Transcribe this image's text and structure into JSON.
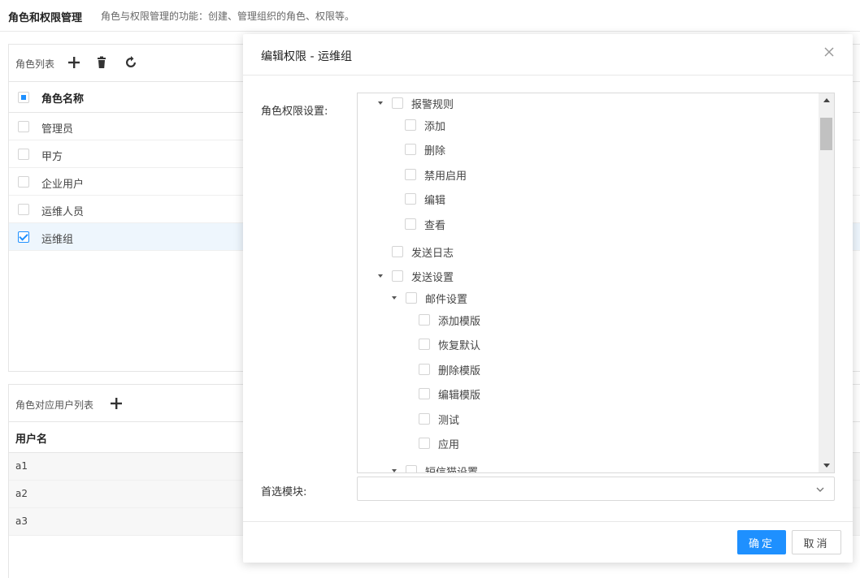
{
  "header": {
    "title": "角色和权限管理",
    "description": "角色与权限管理的功能：创建、管理组织的角色、权限等。"
  },
  "role_panel": {
    "title": "角色列表",
    "column_header": "角色名称",
    "roles": [
      {
        "name": "管理员",
        "checked": false
      },
      {
        "name": "甲方",
        "checked": false
      },
      {
        "name": "企业用户",
        "checked": false
      },
      {
        "name": "运维人员",
        "checked": false
      },
      {
        "name": "运维组",
        "checked": true
      }
    ]
  },
  "user_panel": {
    "title": "角色对应用户列表",
    "column_header": "用户名",
    "users": [
      "a1",
      "a2",
      "a3"
    ]
  },
  "modal": {
    "title": "编辑权限 - 运维组",
    "permission_label": "角色权限设置:",
    "tree": {
      "alert_rules": {
        "label": "报警规则",
        "children": [
          "添加",
          "删除",
          "禁用启用",
          "编辑",
          "查看"
        ]
      },
      "send_log": {
        "label": "发送日志"
      },
      "send_settings": {
        "label": "发送设置",
        "mail_settings": {
          "label": "邮件设置",
          "children": [
            "添加模版",
            "恢复默认",
            "删除模版",
            "编辑模版",
            "测试",
            "应用"
          ]
        },
        "sms_settings": {
          "label": "短信猫设置"
        }
      }
    },
    "module_label": "首选模块:",
    "module_value": "",
    "confirm_label": "确定",
    "cancel_label": "取消"
  },
  "icons": {
    "add": "plus-icon",
    "delete": "trash-icon",
    "refresh": "refresh-icon",
    "close": "close-icon",
    "dropdown": "chevron-down-icon"
  },
  "colors": {
    "primary": "#1e90ff",
    "selected_row": "#eef6fd"
  }
}
